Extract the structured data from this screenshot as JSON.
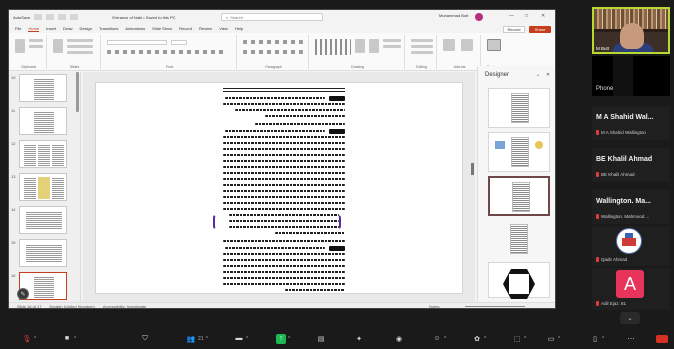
{
  "shared_screen": {
    "title_bar": {
      "autosave": "AutoSave",
      "filename": "Entrance of Nabi • Saved to this PC",
      "search_placeholder": "Search",
      "user_name": "Muhammad Butt",
      "window_controls": [
        "—",
        "□",
        "✕"
      ]
    },
    "ribbon_tabs": [
      "File",
      "Home",
      "Insert",
      "Draw",
      "Design",
      "Transitions",
      "Animations",
      "Slide Show",
      "Record",
      "Review",
      "View",
      "Help"
    ],
    "active_tab": "Home",
    "record_button": "Record",
    "share_button": "Share",
    "ribbon_groups": [
      "Clipboard",
      "Slides",
      "Font",
      "Paragraph",
      "Drawing",
      "Editing",
      "Add-ins",
      "Designer"
    ],
    "slide_numbers": [
      "10",
      "11",
      "12",
      "13",
      "14",
      "15",
      "16"
    ],
    "designer_pane": {
      "title": "Designer",
      "controls": [
        "⌄",
        "✕"
      ]
    },
    "status_bar": {
      "slide_info": "Slide 16 of 17",
      "language": "English (United Kingdom)",
      "accessibility": "Accessibility: Investigate",
      "notes": "Notes"
    }
  },
  "participants": [
    {
      "display": "M Butt",
      "type": "video",
      "active_speaker": true
    },
    {
      "display": "Phone",
      "type": "phone"
    },
    {
      "display": "M A Shahid Wal...",
      "sub": "M A Shahid Wallington",
      "muted": true
    },
    {
      "display": "BE Khalil Ahmad",
      "sub": "BE Khalil Ahmad",
      "muted": true
    },
    {
      "display": "Wallington. Ma...",
      "sub": "Wallington. Mahmood ...",
      "muted": true
    },
    {
      "display": "Qadir Ahmad",
      "sub": "Qadir Ahmad",
      "muted": true,
      "type": "logo"
    },
    {
      "display": "A",
      "sub": "Adil Ejaz. 81",
      "muted": true,
      "type": "avatar",
      "avatar_color": "#e8335a"
    }
  ],
  "toolbar": {
    "participants_count": "21",
    "items": [
      "Audio",
      "Video",
      "Security",
      "Participants",
      "Chat",
      "Share Screen",
      "Summary",
      "AI Companion",
      "Record",
      "Reactions",
      "Apps",
      "Whiteboards",
      "More",
      "End"
    ]
  },
  "colors": {
    "accent": "#c43e1c",
    "active_speaker_border": "#b8d832",
    "share_green": "#1db954",
    "end_red": "#d93025"
  }
}
